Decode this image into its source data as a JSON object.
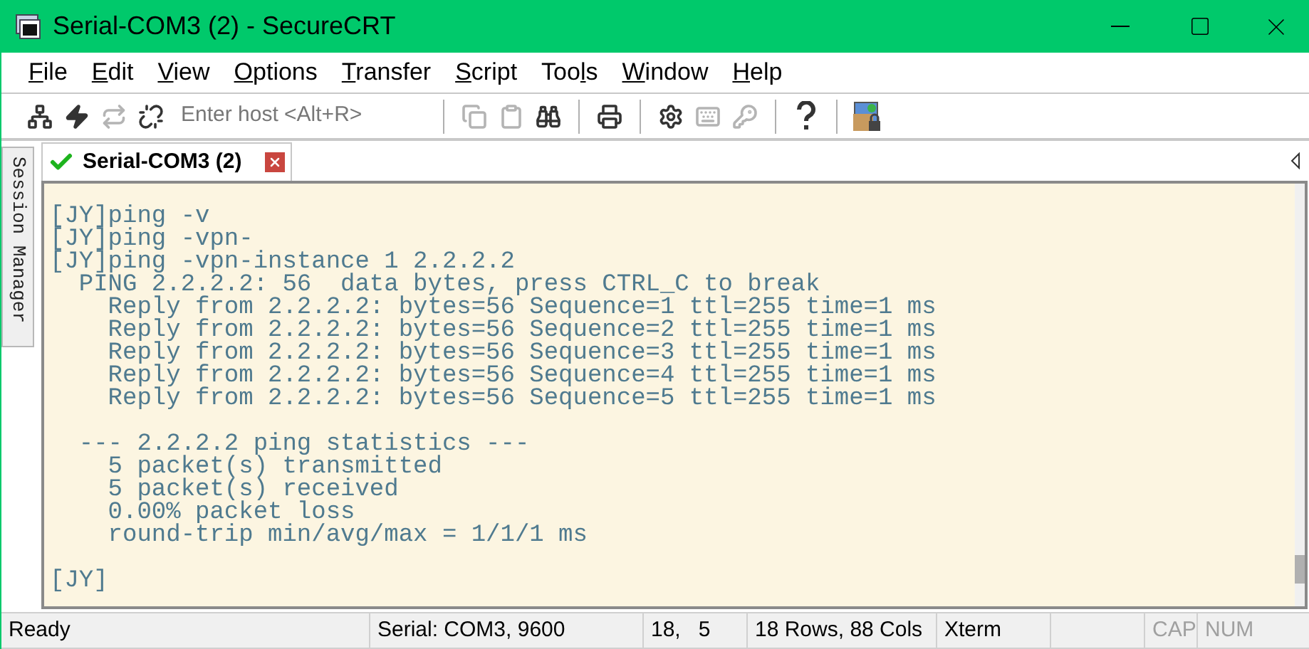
{
  "window": {
    "title": "Serial-COM3 (2) - SecureCRT"
  },
  "menu": [
    {
      "key": "F",
      "after": "ile"
    },
    {
      "key": "E",
      "after": "dit"
    },
    {
      "key": "V",
      "after": "iew"
    },
    {
      "key": "O",
      "after": "ptions"
    },
    {
      "key": "T",
      "after": "ransfer"
    },
    {
      "key": "S",
      "after": "cript"
    },
    {
      "before": "Too",
      "key": "l",
      "after": "s"
    },
    {
      "key": "W",
      "after": "indow"
    },
    {
      "key": "H",
      "after": "elp"
    }
  ],
  "toolbar": {
    "connect_buttons": [
      {
        "enabled": true
      },
      {
        "enabled": true
      },
      {
        "enabled": false
      },
      {
        "enabled": true
      }
    ],
    "host_field": {
      "placeholder": "Enter host <Alt+R>"
    },
    "edit_buttons": [
      {
        "enabled": false
      },
      {
        "enabled": false
      },
      {
        "enabled": true
      }
    ],
    "print_buttons": [
      {
        "enabled": true
      }
    ],
    "option_buttons": [
      {
        "enabled": true
      },
      {
        "enabled": false
      },
      {
        "enabled": false
      }
    ],
    "help_buttons": [
      {
        "enabled": true
      }
    ],
    "transfer_buttons": [
      {
        "enabled": true
      }
    ]
  },
  "side_panel": {
    "label": "Session Manager"
  },
  "tabs": [
    {
      "label": "Serial-COM3 (2)",
      "selected": true,
      "connected": true
    }
  ],
  "terminal": {
    "blocks": [
      [
        "[JY]ping -v",
        "[JY]ping -vpn-",
        "[JY]ping -vpn-instance 1 2.2.2.2",
        "  PING 2.2.2.2: 56  data bytes, press CTRL_C to break",
        "    Reply from 2.2.2.2: bytes=56 Sequence=1 ttl=255 time=1 ms",
        "    Reply from 2.2.2.2: bytes=56 Sequence=2 ttl=255 time=1 ms",
        "    Reply from 2.2.2.2: bytes=56 Sequence=3 ttl=255 time=1 ms",
        "    Reply from 2.2.2.2: bytes=56 Sequence=4 ttl=255 time=1 ms",
        "    Reply from 2.2.2.2: bytes=56 Sequence=5 ttl=255 time=1 ms"
      ],
      [
        "  --- 2.2.2.2 ping statistics ---",
        "    5 packet(s) transmitted",
        "    5 packet(s) received",
        "    0.00% packet loss",
        "    round-trip min/avg/max = 1/1/1 ms"
      ],
      [
        "[JY]"
      ]
    ]
  },
  "status_bar": [
    {
      "text": "Ready",
      "disabled": false
    },
    {
      "text": "Serial: COM3, 9600",
      "disabled": false
    },
    {
      "text": "18,   5",
      "disabled": false
    },
    {
      "text": "18 Rows, 88 Cols",
      "disabled": false
    },
    {
      "text": "Xterm",
      "disabled": false
    },
    {
      "text": "CAP",
      "disabled": true
    },
    {
      "text": "NUM",
      "disabled": true
    }
  ]
}
